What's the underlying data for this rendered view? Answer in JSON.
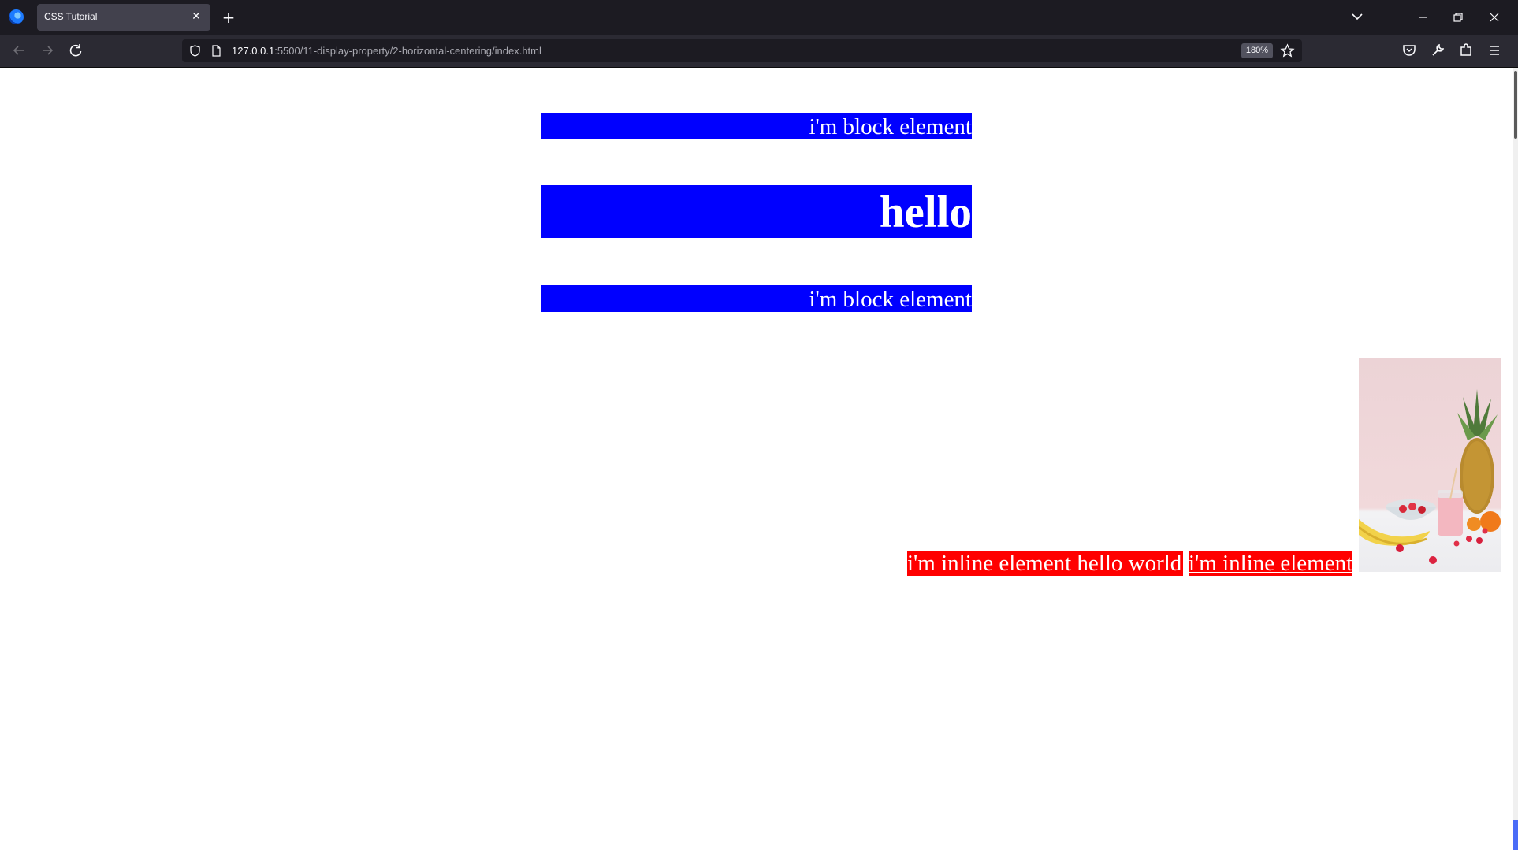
{
  "browser": {
    "tab": {
      "title": "CSS Tutorial"
    },
    "url": {
      "host": "127.0.0.1",
      "path": ":5500/11-display-property/2-horizontal-centering/index.html"
    },
    "zoom": "180%"
  },
  "page": {
    "block_element_1": "i'm block element",
    "heading": "hello",
    "block_element_2": "i'm block element",
    "inline_element_1": "i'm inline element hello world",
    "inline_element_2": "i'm inline element",
    "image_alt": "fruits and smoothie photo"
  },
  "colors": {
    "block_bg": "#0000ff",
    "inline_bg": "#ff0000",
    "text": "#ffffff"
  }
}
